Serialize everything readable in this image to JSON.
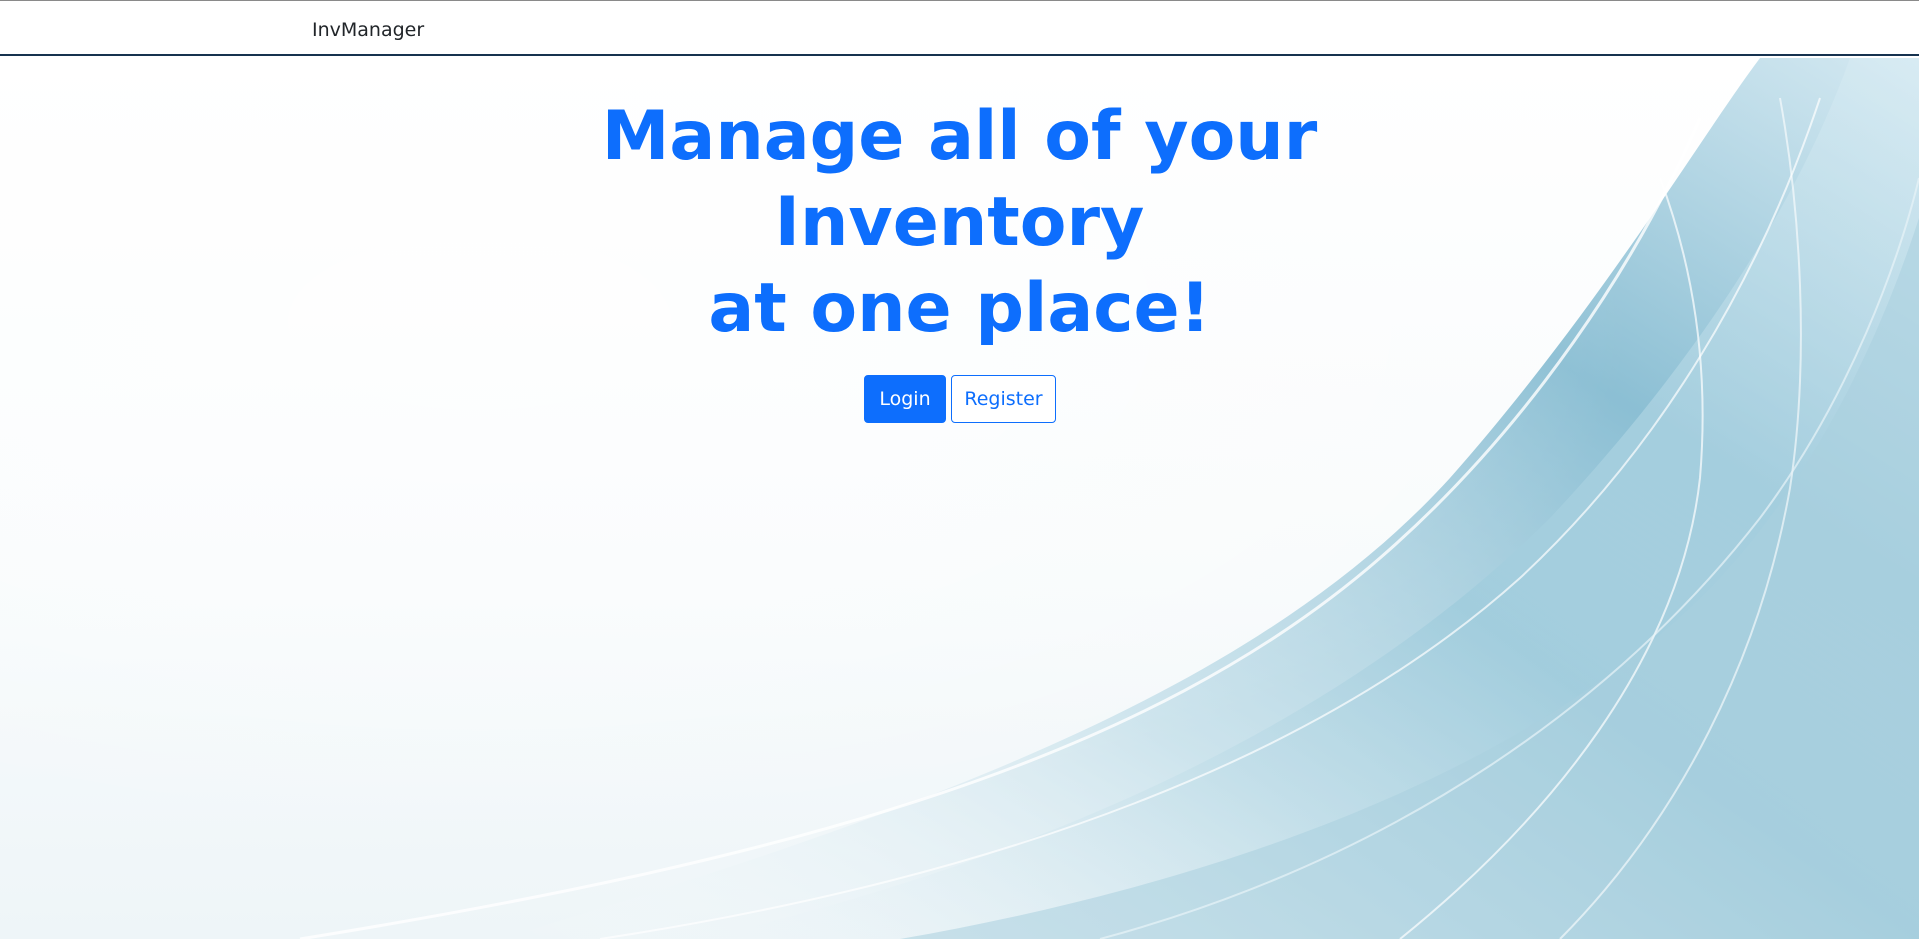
{
  "navbar": {
    "brand": "InvManager"
  },
  "hero": {
    "headline_lines": [
      "Manage all of your",
      "Inventory",
      "at one place!"
    ],
    "login_label": "Login",
    "register_label": "Register"
  },
  "colors": {
    "accent": "#0d6efd",
    "navbar_border": "#16324f",
    "background_wave": "#8fc4d8"
  }
}
